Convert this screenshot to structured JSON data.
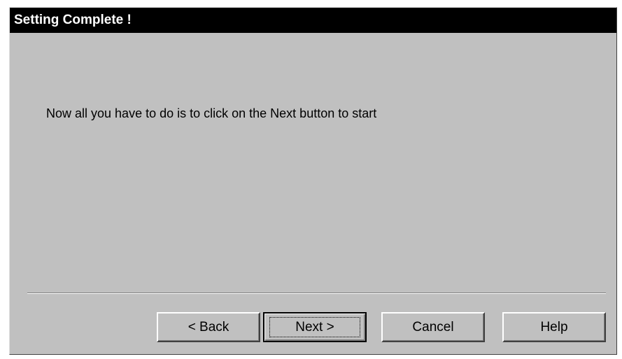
{
  "dialog": {
    "title": "Setting Complete !",
    "message": "Now all you have to do is to click on the Next button to start"
  },
  "buttons": {
    "back_label": "< Back",
    "next_label": "Next >",
    "cancel_label": "Cancel",
    "help_label": "Help"
  }
}
